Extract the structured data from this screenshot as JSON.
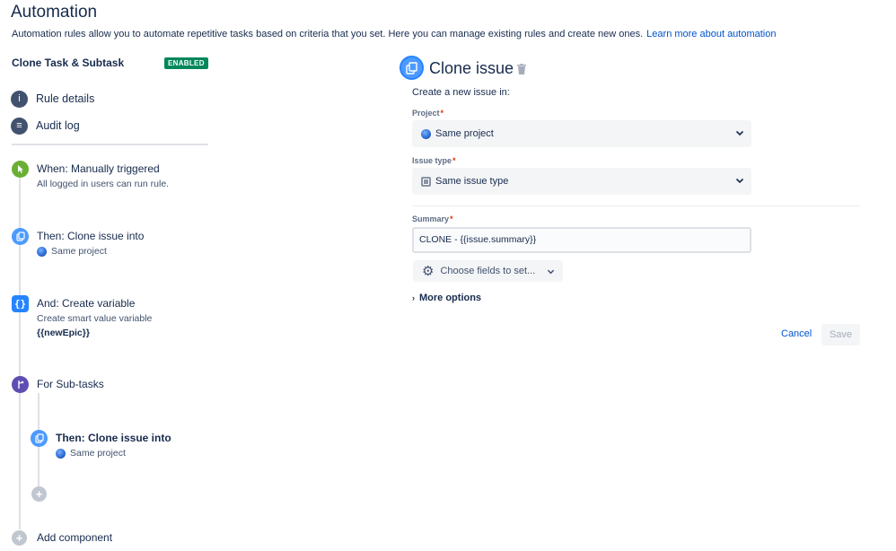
{
  "page": {
    "title": "Automation",
    "description": "Automation rules allow you to automate repetitive tasks based on criteria that you set. Here you can manage existing rules and create new ones.",
    "learn_more": "Learn more about automation"
  },
  "rule": {
    "name": "Clone Task & Subtask",
    "status": "ENABLED",
    "status_color": "#00875a"
  },
  "nav": {
    "rule_details": "Rule details",
    "audit_log": "Audit log"
  },
  "steps": {
    "trigger": {
      "title": "When: Manually triggered",
      "sub": "All logged in users can run rule.",
      "icon": "cursor-icon",
      "color": "#6aaf35"
    },
    "clone1": {
      "title": "Then: Clone issue into",
      "sub": "Same project",
      "icon": "clone-icon",
      "color": "#4c9aff"
    },
    "variable": {
      "title": "And: Create variable",
      "sub": "Create smart value variable",
      "sub2": "{{newEpic}}",
      "icon": "braces-icon",
      "color": "#2684ff"
    },
    "branch": {
      "title": "For Sub-tasks",
      "icon": "branch-icon",
      "color": "#5e4db2"
    },
    "clone2": {
      "title": "Then: Clone issue into",
      "sub": "Same project",
      "icon": "clone-icon",
      "color": "#4c9aff"
    },
    "add_component": "Add component"
  },
  "editor": {
    "title": "Clone issue",
    "create_label": "Create a new issue in:",
    "project_label": "Project",
    "project_value": "Same project",
    "issue_type_label": "Issue type",
    "issue_type_value": "Same issue type",
    "summary_label": "Summary",
    "summary_value": "CLONE - {{issue.summary}}",
    "choose_fields": "Choose fields to set...",
    "more_options": "More options",
    "cancel": "Cancel",
    "save": "Save",
    "required_mark": "*"
  }
}
